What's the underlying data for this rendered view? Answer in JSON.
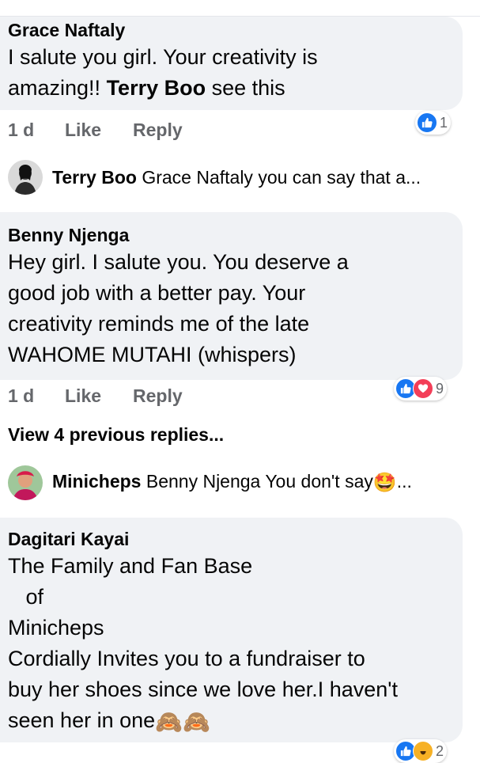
{
  "comments": [
    {
      "author": "Grace Naftaly",
      "text_before": "I salute you girl. Your creativity is\namazing!! ",
      "mention": "Terry Boo",
      "text_after": " see this",
      "time": "1 d",
      "like_label": "Like",
      "reply_label": "Reply",
      "reactions": [
        "like"
      ],
      "reaction_count": "1"
    },
    {
      "author": "Benny Njenga",
      "text": "Hey girl. I salute you. You deserve a\ngood job with a better pay. Your\ncreativity reminds me of the late\nWAHOME MUTAHI (whispers)",
      "time": "1 d",
      "like_label": "Like",
      "reply_label": "Reply",
      "reactions": [
        "like",
        "love"
      ],
      "reaction_count": "9"
    },
    {
      "author": "Dagitari Kayai",
      "text": "The Family and Fan Base\n   of\nMinicheps\nCordially Invites you to a fundraiser to\nbuy her shoes since we love her.I haven't\nseen her in one",
      "emoji": "🙈🙈",
      "reactions": [
        "like",
        "haha"
      ],
      "reaction_count": "2"
    }
  ],
  "replies": [
    {
      "author": "Terry Boo",
      "text": "Grace Naftaly you can say that a..."
    },
    {
      "author": "Minicheps",
      "text": "Benny Njenga You don't say",
      "emoji": "🤩",
      "ellipsis": "..."
    }
  ],
  "view_previous": "View 4 previous replies..."
}
